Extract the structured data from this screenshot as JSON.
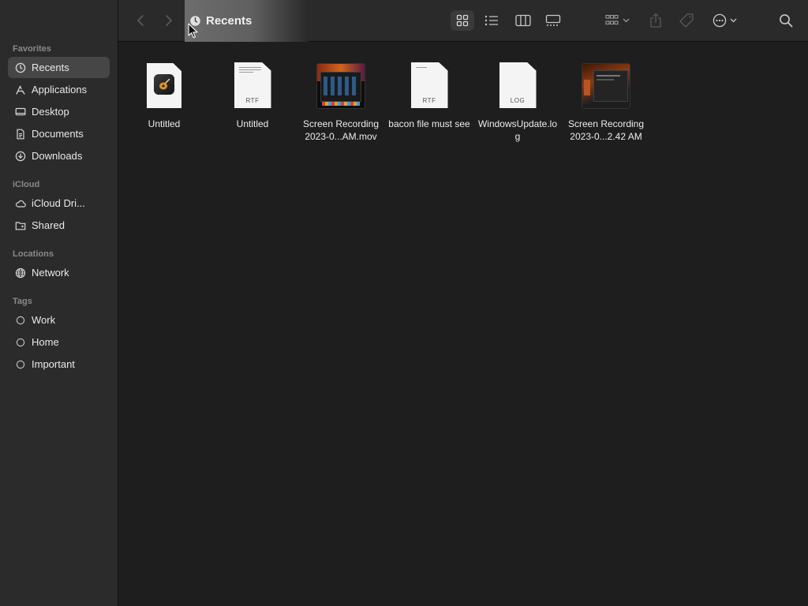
{
  "sidebar": {
    "sections": [
      {
        "label": "Favorites",
        "items": [
          {
            "label": "Recents",
            "icon": "clock-icon",
            "selected": true
          },
          {
            "label": "Applications",
            "icon": "applications-icon"
          },
          {
            "label": "Desktop",
            "icon": "desktop-icon"
          },
          {
            "label": "Documents",
            "icon": "document-icon"
          },
          {
            "label": "Downloads",
            "icon": "download-icon"
          }
        ]
      },
      {
        "label": "iCloud",
        "items": [
          {
            "label": "iCloud Dri...",
            "icon": "cloud-icon"
          },
          {
            "label": "Shared",
            "icon": "shared-folder-icon"
          }
        ]
      },
      {
        "label": "Locations",
        "items": [
          {
            "label": "Network",
            "icon": "globe-icon"
          }
        ]
      },
      {
        "label": "Tags",
        "items": [
          {
            "label": "Work",
            "icon": "tag-circle-icon"
          },
          {
            "label": "Home",
            "icon": "tag-circle-icon"
          },
          {
            "label": "Important",
            "icon": "tag-circle-icon"
          }
        ]
      }
    ]
  },
  "toolbar": {
    "title": "Recents",
    "active_view": "icon-view"
  },
  "files": [
    {
      "name": "Untitled",
      "kind": "app-doc"
    },
    {
      "name": "Untitled",
      "kind": "doc",
      "ext": "RTF"
    },
    {
      "name": "Screen Recording 2023-0...AM.mov",
      "kind": "video"
    },
    {
      "name": "bacon file must see",
      "kind": "doc",
      "ext": "RTF"
    },
    {
      "name": "WindowsUpdate.log",
      "kind": "doc",
      "ext": "LOG"
    },
    {
      "name": "Screen Recording 2023-0...2.42 AM",
      "kind": "video"
    }
  ],
  "colors": {
    "sidebar_bg": "#2b2b2c",
    "content_bg": "#1e1e1e",
    "selected_bg": "#464646"
  }
}
